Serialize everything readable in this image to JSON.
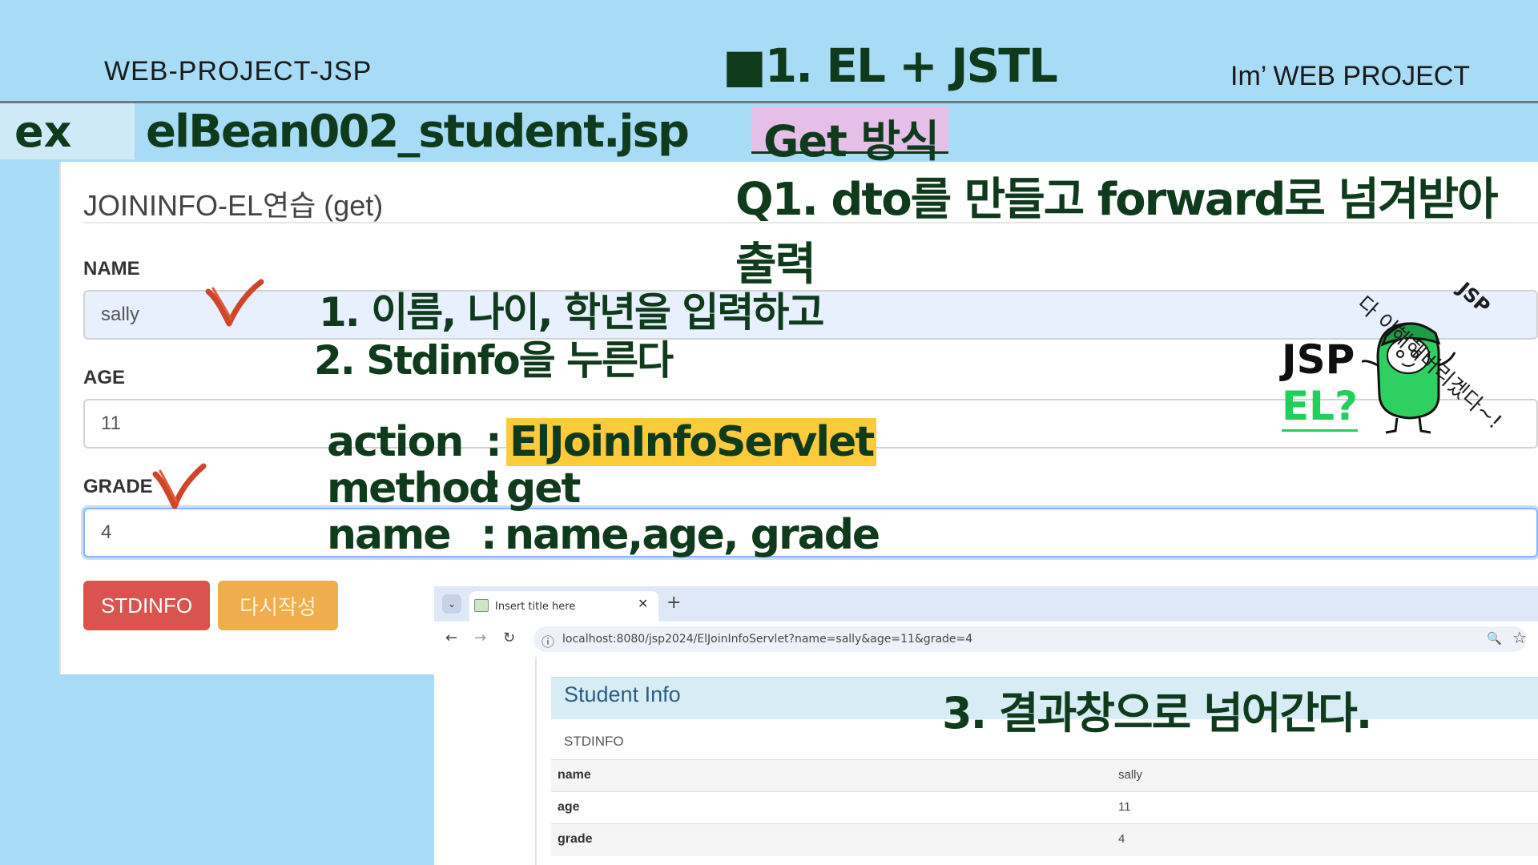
{
  "header": {
    "left": "WEB-PROJECT-JSP",
    "center": "■1. EL + JSTL",
    "right": "Im’  WEB PROJECT"
  },
  "subheader": {
    "ex": "ex",
    "file": "elBean002_student.jsp",
    "method_tag": "Get 방식"
  },
  "form": {
    "title": "JOININFO-EL연습 (get)",
    "name_label": "NAME",
    "name_value": "sally",
    "age_label": "AGE",
    "age_value": "11",
    "grade_label": "GRADE",
    "grade_value": "4",
    "submit_label": "STDINFO",
    "reset_label": "다시작성"
  },
  "notes": {
    "q1": "Q1. dto를 만들고 forward로 넘겨받아 출력",
    "step1": "1. 이름, 나이, 학년을 입력하고",
    "step2": "2. Stdinfo을 누른다",
    "action_key": "action",
    "action_colon": ":",
    "action_val": "ElJoinInfoServlet",
    "method_key": "method",
    "method_colon": ":",
    "method_val": "get",
    "name_key": "name",
    "name_colon": ":",
    "name_val": "name,age, grade",
    "step3": "3.   결과창으로 넘어간다."
  },
  "browser": {
    "tab_title": "Insert title here",
    "tab_close": "✕",
    "tab_new": "+",
    "url": "localhost:8080/jsp2024/ElJoinInfoServlet?name=sally&age=11&grade=4",
    "back": "←",
    "forward": "→",
    "reload": "↻",
    "zoom": "🔍",
    "star": "☆",
    "info": "ⓘ",
    "dropdown": "⌄"
  },
  "result": {
    "title": "Student Info",
    "subtitle": "STDINFO",
    "rows": [
      {
        "key": "name",
        "value": "sally"
      },
      {
        "key": "age",
        "value": "11"
      },
      {
        "key": "grade",
        "value": "4"
      }
    ]
  },
  "mascot": {
    "jsp": "JSP",
    "el": "EL?",
    "bubble": "다 이해해버리겠다~!",
    "bubble_tag": "JSP"
  },
  "colors": {
    "background": "#a8dcf6",
    "heading_green": "#0f3a1c",
    "highlight_yellow": "#fccb3c",
    "tag_purple": "#e6bfe9",
    "btn_red": "#d9534f",
    "btn_orange": "#f0ad4e",
    "mascot_green": "#1fd15a",
    "check_red": "#d0442a"
  }
}
